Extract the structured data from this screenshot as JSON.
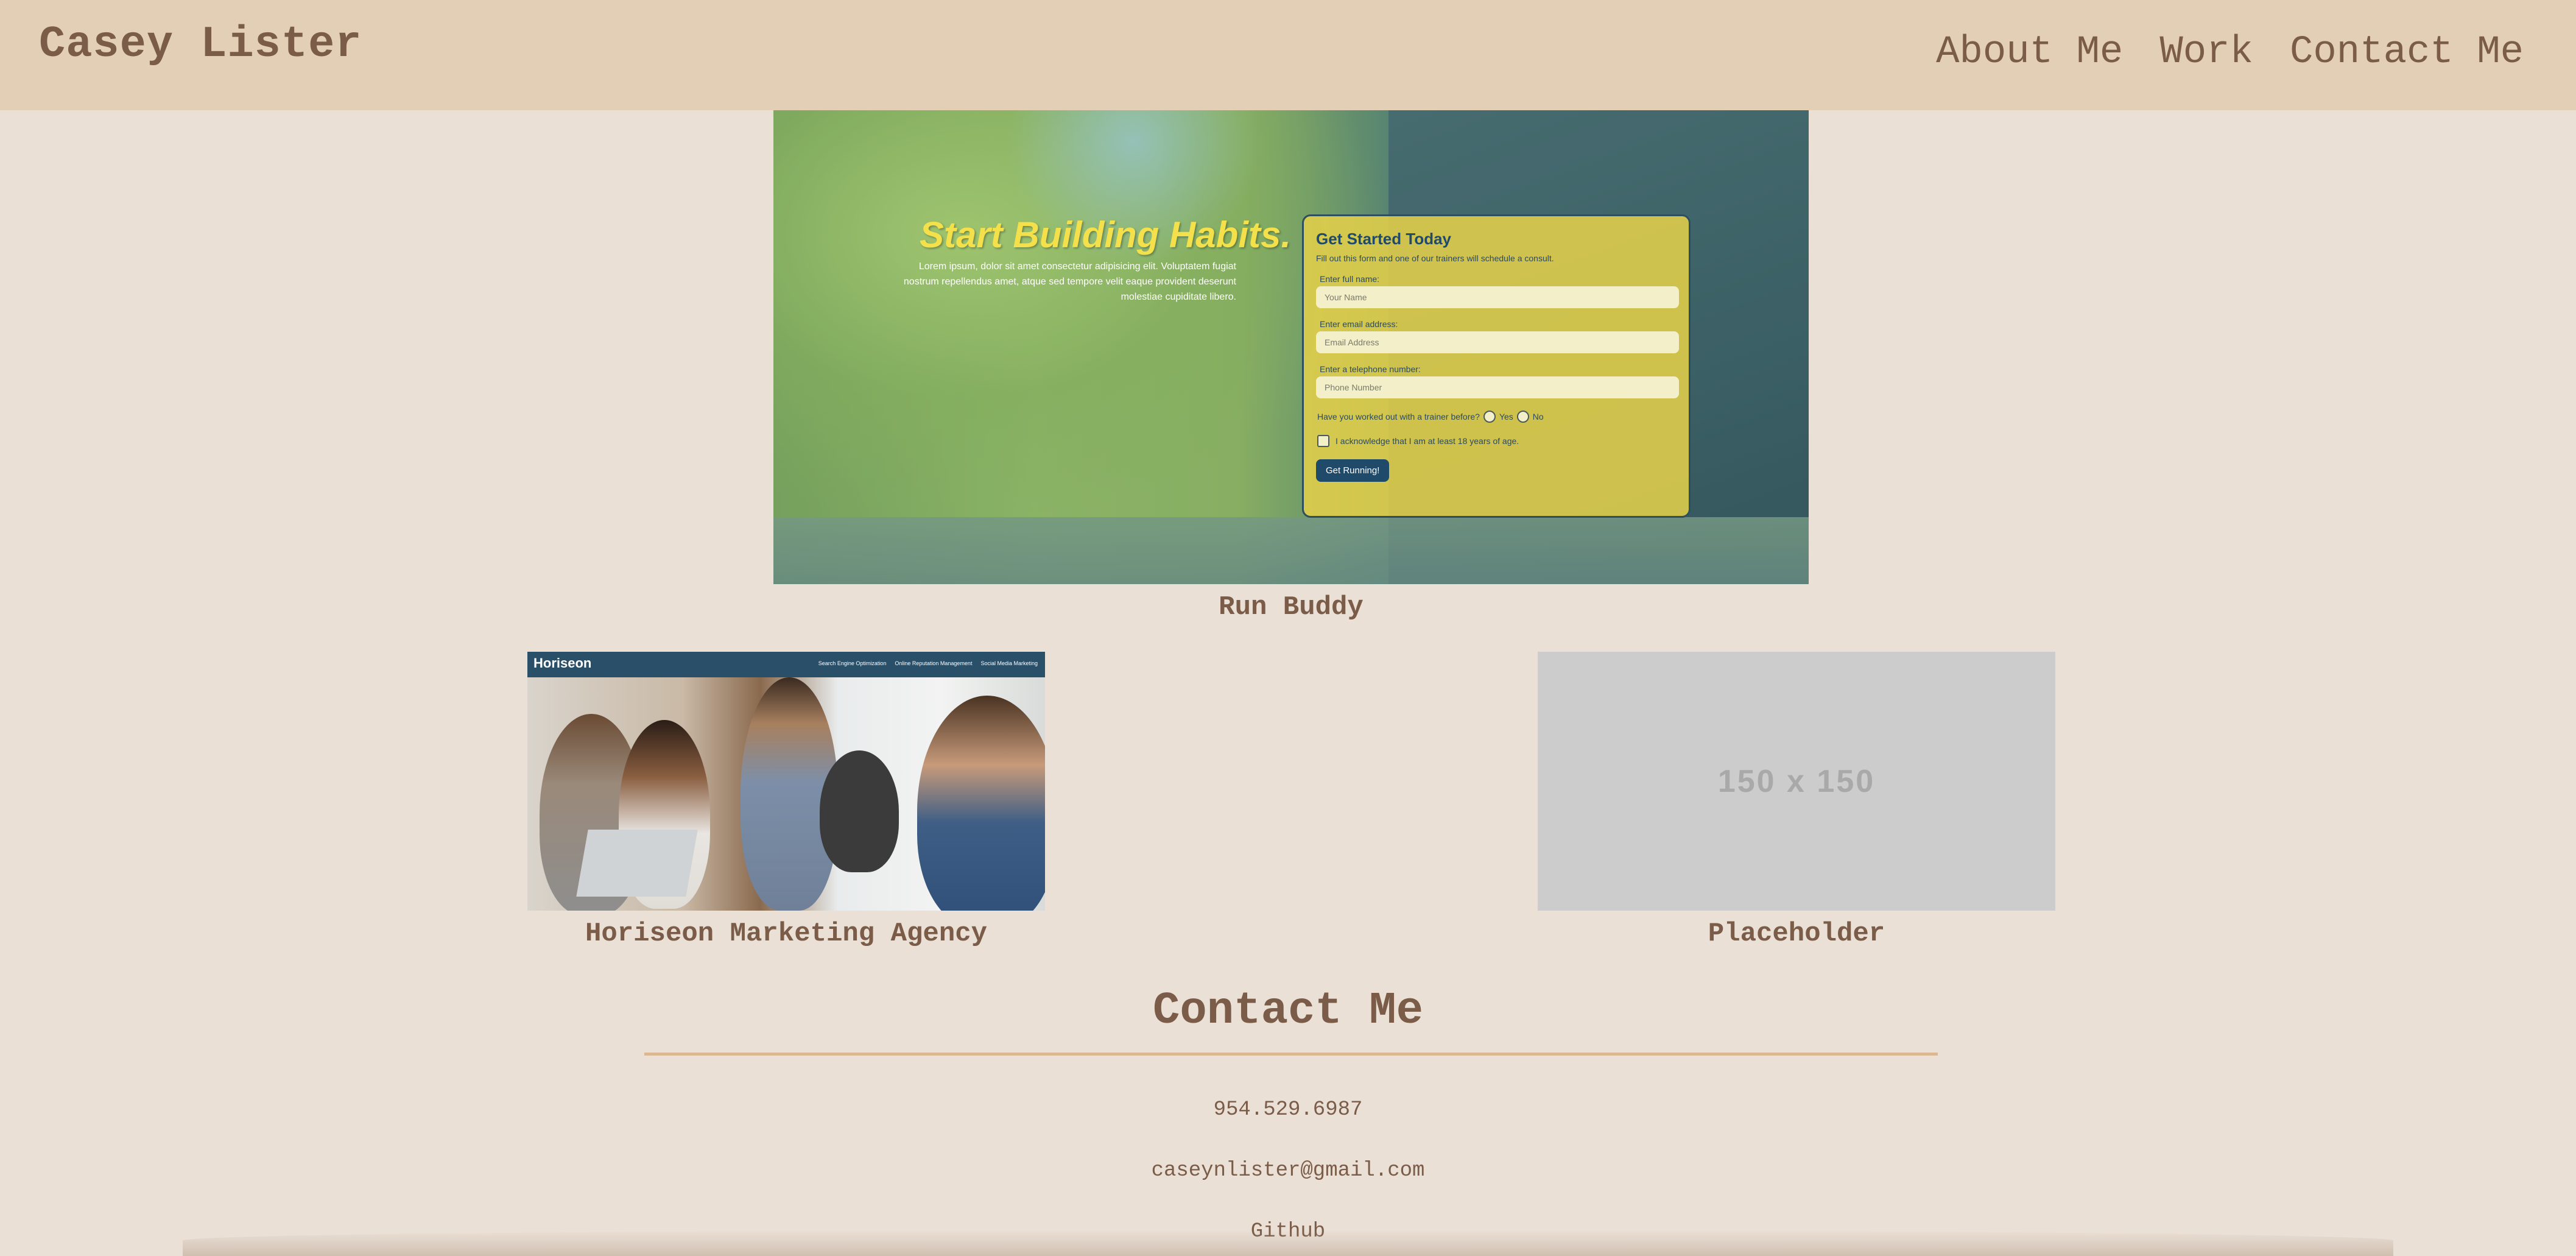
{
  "header": {
    "brand": "Casey Lister",
    "nav": [
      "About Me",
      "Work",
      "Contact Me"
    ]
  },
  "work": {
    "featured": {
      "caption": "Run Buddy",
      "screenshot": {
        "hero_title": "Start Building Habits.",
        "hero_text": "Lorem ipsum, dolor sit amet consectetur adipisicing elit. Voluptatem fugiat nostrum repellendus amet, atque sed tempore velit eaque provident deserunt molestiae cupiditate libero.",
        "form_title": "Get Started Today",
        "form_subtitle": "Fill out this form and one of our trainers will schedule a consult.",
        "label_name": "Enter full name:",
        "placeholder_name": "Your Name",
        "label_email": "Enter email address:",
        "placeholder_email": "Email Address",
        "label_phone": "Enter a telephone number:",
        "placeholder_phone": "Phone Number",
        "question": "Have you worked out with a trainer before?",
        "option_yes": "Yes",
        "option_no": "No",
        "acknowledge": "I acknowledge that I am at least 18 years of age.",
        "button": "Get Running!"
      }
    },
    "projects": [
      {
        "caption": "Horiseon Marketing Agency",
        "screenshot": {
          "logo": "Horiseon",
          "links": [
            "Search Engine Optimization",
            "Online Reputation Management",
            "Social Media Marketing"
          ]
        }
      },
      {
        "caption": "Placeholder",
        "image_text": "150 x 150"
      }
    ]
  },
  "contact": {
    "title": "Contact Me",
    "phone": "954.529.6987",
    "email": "caseynlister@gmail.com",
    "github": "Github"
  },
  "colors": {
    "page_bg": "#ebe0d6",
    "header_bg": "#e3cfb6",
    "text": "#7a5c48",
    "rule": "#dcb892"
  }
}
